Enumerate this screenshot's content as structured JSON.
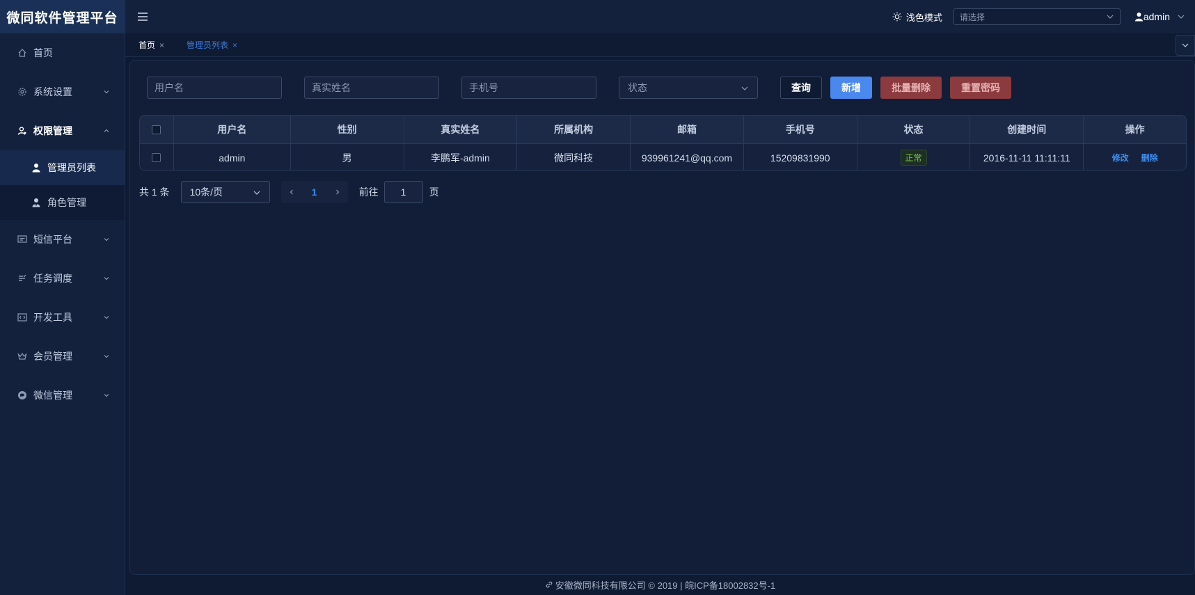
{
  "app": {
    "title": "微同软件管理平台"
  },
  "sidebar": {
    "items": [
      {
        "label": "首页"
      },
      {
        "label": "系统设置"
      },
      {
        "label": "权限管理",
        "children": [
          {
            "label": "管理员列表"
          },
          {
            "label": "角色管理"
          }
        ]
      },
      {
        "label": "短信平台"
      },
      {
        "label": "任务调度"
      },
      {
        "label": "开发工具"
      },
      {
        "label": "会员管理"
      },
      {
        "label": "微信管理"
      }
    ]
  },
  "header": {
    "theme_label": "浅色模式",
    "select_placeholder": "请选择",
    "user": "admin"
  },
  "tabs": [
    {
      "label": "首页",
      "close": "×"
    },
    {
      "label": "管理员列表",
      "close": "×"
    }
  ],
  "filters": {
    "username_placeholder": "用户名",
    "realname_placeholder": "真实姓名",
    "phone_placeholder": "手机号",
    "status_placeholder": "状态",
    "query_button": "查询",
    "add_button": "新增",
    "batch_delete_button": "批量删除",
    "reset_password_button": "重置密码"
  },
  "table": {
    "columns": [
      "用户名",
      "性别",
      "真实姓名",
      "所属机构",
      "邮箱",
      "手机号",
      "状态",
      "创建时间",
      "操作"
    ],
    "rows": [
      {
        "username": "admin",
        "gender": "男",
        "realname": "李鹏军-admin",
        "org": "微同科技",
        "email": "939961241@qq.com",
        "phone": "15209831990",
        "status": "正常",
        "created": "2016-11-11 11:11:11",
        "edit": "修改",
        "delete": "删除"
      }
    ]
  },
  "pager": {
    "total": "共 1 条",
    "page_size": "10条/页",
    "current_page": "1",
    "goto_label": "前往",
    "goto_value": "1",
    "goto_suffix": "页"
  },
  "footer": {
    "text": "安徽微同科技有限公司 © 2019 | 皖ICP备18002832号-1"
  },
  "colors": {
    "accent": "#4a88ee",
    "danger": "#8b3a3e",
    "success": "#7ac943",
    "background": "#0f1a33"
  }
}
